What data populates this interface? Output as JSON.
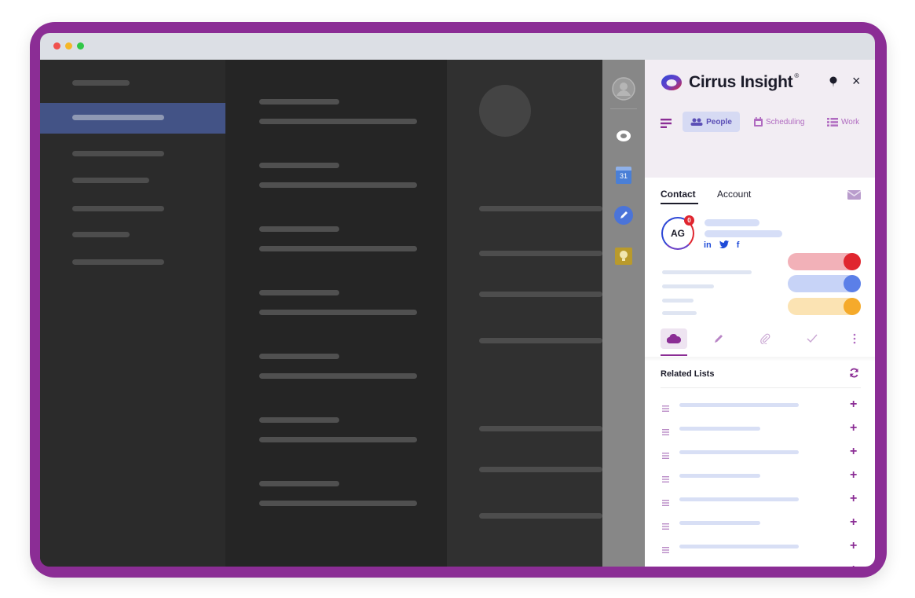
{
  "app": {
    "brand_name": "Cirrus Insight",
    "brand_mark": "®"
  },
  "panel": {
    "close_label": "×",
    "tabs": [
      {
        "label": "People",
        "icon": "people-icon",
        "active": true
      },
      {
        "label": "Scheduling",
        "icon": "calendar-icon",
        "active": false
      },
      {
        "label": "Work",
        "icon": "list-icon",
        "active": false
      }
    ],
    "contact_tabs": {
      "contact": "Contact",
      "account": "Account"
    },
    "contact": {
      "initials": "AG",
      "badge_count": "0",
      "social": [
        "in",
        "🐦",
        "f"
      ]
    },
    "toggles": [
      {
        "color": "#e0262f",
        "track": "#f2b1b8"
      },
      {
        "color": "#5b7fe8",
        "track": "#c7d3f7"
      },
      {
        "color": "#f5aa2b",
        "track": "#fbe3b3"
      }
    ],
    "related_lists": {
      "title": "Related Lists",
      "add_label": "+",
      "row_count": 8
    }
  },
  "rail": {
    "calendar_day": "31"
  },
  "colors": {
    "frame": "#8b2d95",
    "accent": "#5b4fb6",
    "selection": "#435386"
  }
}
